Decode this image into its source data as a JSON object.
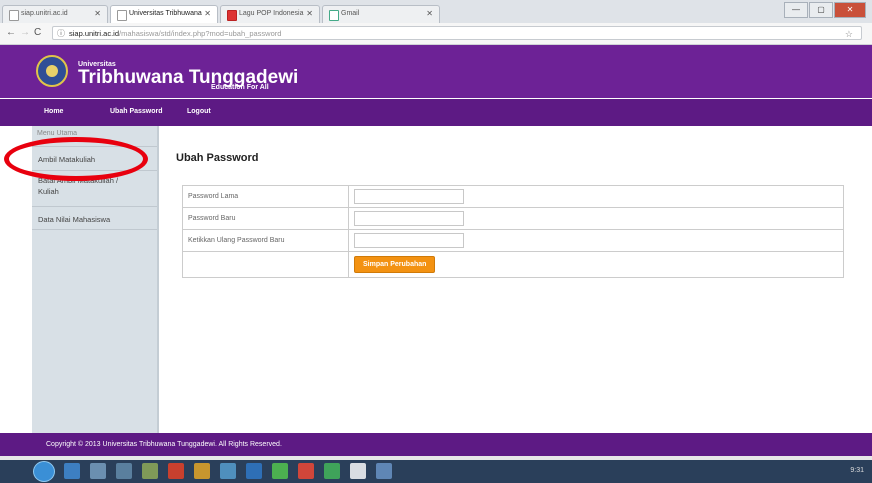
{
  "browser": {
    "tabs": [
      {
        "title": "siap.unitri.ac.id",
        "active": false
      },
      {
        "title": "Universitas Tribhuwana",
        "active": true
      },
      {
        "title": "Lagu POP Indonesia",
        "active": false
      },
      {
        "title": "Gmail",
        "active": false
      }
    ],
    "url_domain": "siap.unitri.ac.id",
    "url_path": "/mahasiswa/std/index.php?mod=ubah_password",
    "win_min": "—",
    "win_max": "▢",
    "win_close": "✕"
  },
  "header": {
    "small": "Universitas",
    "title": "Tribhuwana Tunggadewi",
    "tagline": "Education For All"
  },
  "nav": [
    "Home",
    "Ubah Password",
    "Logout"
  ],
  "sidebar": {
    "title": "Menu Utama",
    "items": [
      {
        "label": "Ambil Matakuliah"
      },
      {
        "label": "Batal Ambil Matakuliah / Kuliah"
      },
      {
        "label": "Data Nilai Mahasiswa"
      }
    ]
  },
  "main": {
    "title": "Ubah Password",
    "fields": [
      {
        "label": "Password Lama",
        "value": ""
      },
      {
        "label": "Password Baru",
        "value": ""
      },
      {
        "label": "Ketikkan Ulang Password Baru",
        "value": ""
      }
    ],
    "submit_label": "Simpan Perubahan"
  },
  "footer": "Copyright © 2013 Universitas Tribhuwana Tunggadewi. All Rights Reserved.",
  "taskbar": {
    "clock": "9:31"
  },
  "colors": {
    "header": "#6d2296",
    "nav": "#5d1a84",
    "button": "#f39212",
    "highlight": "#e8000e"
  }
}
